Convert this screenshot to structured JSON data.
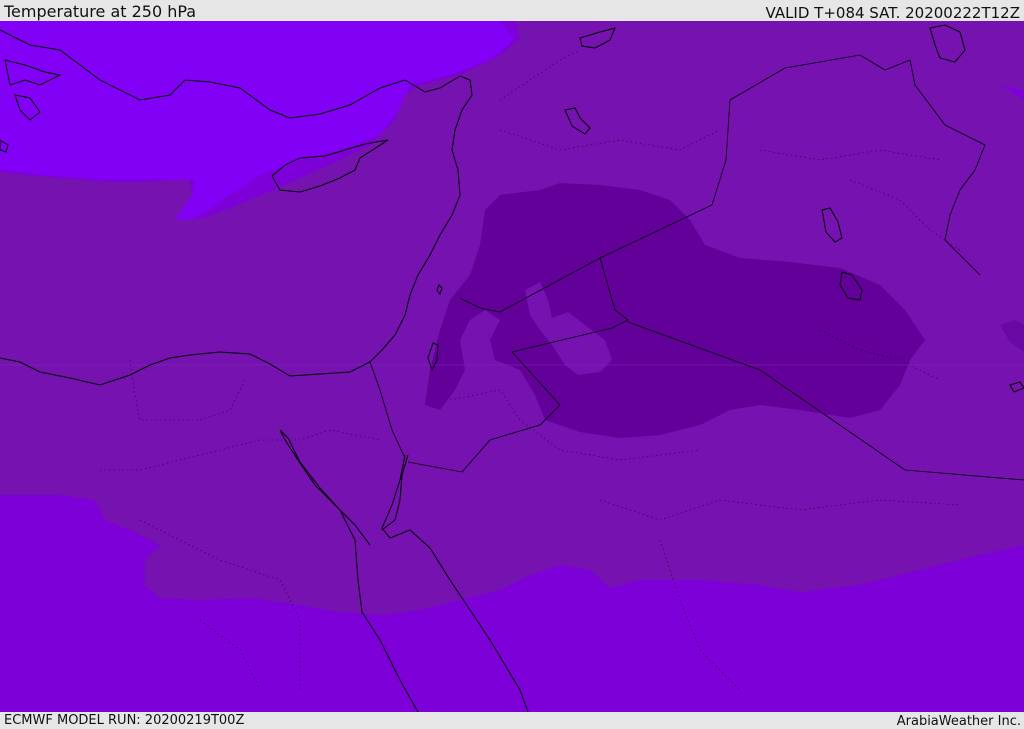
{
  "header": {
    "title": "Temperature at 250 hPa",
    "valid_label": "VALID T+084 SAT. 20200222T12Z"
  },
  "footer": {
    "model_run": "ECMWF MODEL RUN: 20200219T00Z",
    "credit": "ArabiaWeather Inc."
  },
  "map": {
    "field": "temperature",
    "level": "250 hPa",
    "colors": {
      "band_coldest": "#620099",
      "band_cold": "#7512b0",
      "band_mid": "#7e00d8",
      "band_warm": "#8200f5",
      "coastline": "#000000"
    }
  }
}
